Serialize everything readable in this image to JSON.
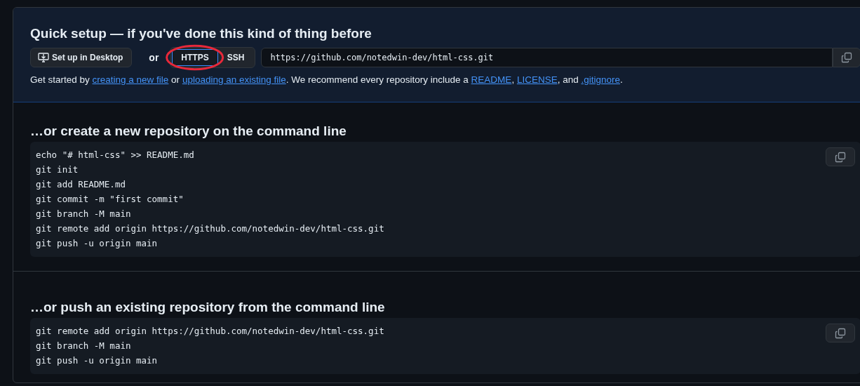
{
  "quick_setup": {
    "title": "Quick setup — if you've done this kind of thing before",
    "desktop_button": "Set up in Desktop",
    "or_label": "or",
    "protocols": [
      {
        "label": "HTTPS",
        "selected": true,
        "circled": true
      },
      {
        "label": "SSH",
        "selected": false,
        "circled": false
      }
    ],
    "url": "https://github.com/notedwin-dev/html-css.git",
    "hint": [
      {
        "kind": "text",
        "text": "Get started by "
      },
      {
        "kind": "link",
        "text": "creating a new file"
      },
      {
        "kind": "text",
        "text": " or "
      },
      {
        "kind": "link",
        "text": "uploading an existing file"
      },
      {
        "kind": "text",
        "text": ". We recommend every repository include a "
      },
      {
        "kind": "link",
        "text": "README"
      },
      {
        "kind": "text",
        "text": ", "
      },
      {
        "kind": "link",
        "text": "LICENSE"
      },
      {
        "kind": "text",
        "text": ", and "
      },
      {
        "kind": "link",
        "text": ".gitignore"
      },
      {
        "kind": "text",
        "text": "."
      }
    ]
  },
  "sections": [
    {
      "heading": "…or create a new repository on the command line",
      "lines": [
        "echo \"# html-css\" >> README.md",
        "git init",
        "git add README.md",
        "git commit -m \"first commit\"",
        "git branch -M main",
        "git remote add origin https://github.com/notedwin-dev/html-css.git",
        "git push -u origin main"
      ]
    },
    {
      "heading": "…or push an existing repository from the command line",
      "lines": [
        "git remote add origin https://github.com/notedwin-dev/html-css.git",
        "git branch -M main",
        "git push -u origin main"
      ]
    }
  ]
}
